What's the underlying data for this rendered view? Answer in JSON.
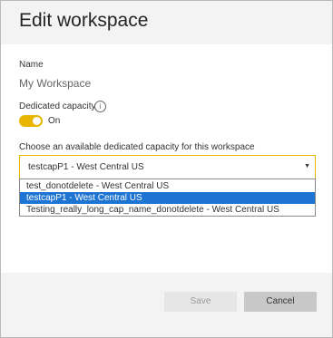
{
  "dialog": {
    "title": "Edit workspace"
  },
  "name_field": {
    "label": "Name",
    "value": "My Workspace"
  },
  "dedicated_capacity": {
    "label": "Dedicated capacity",
    "info_icon": "info-icon",
    "toggle_state": "On",
    "toggle_color": "#e8b500"
  },
  "capacity_select": {
    "label": "Choose an available dedicated capacity for this workspace",
    "selected": "testcapP1 - West Central US",
    "options": [
      "test_donotdelete - West Central US",
      "testcapP1 - West Central US",
      "Testing_really_long_cap_name_donotdelete - West Central US"
    ],
    "highlight_color": "#1e74d2"
  },
  "footer": {
    "save_label": "Save",
    "cancel_label": "Cancel"
  }
}
